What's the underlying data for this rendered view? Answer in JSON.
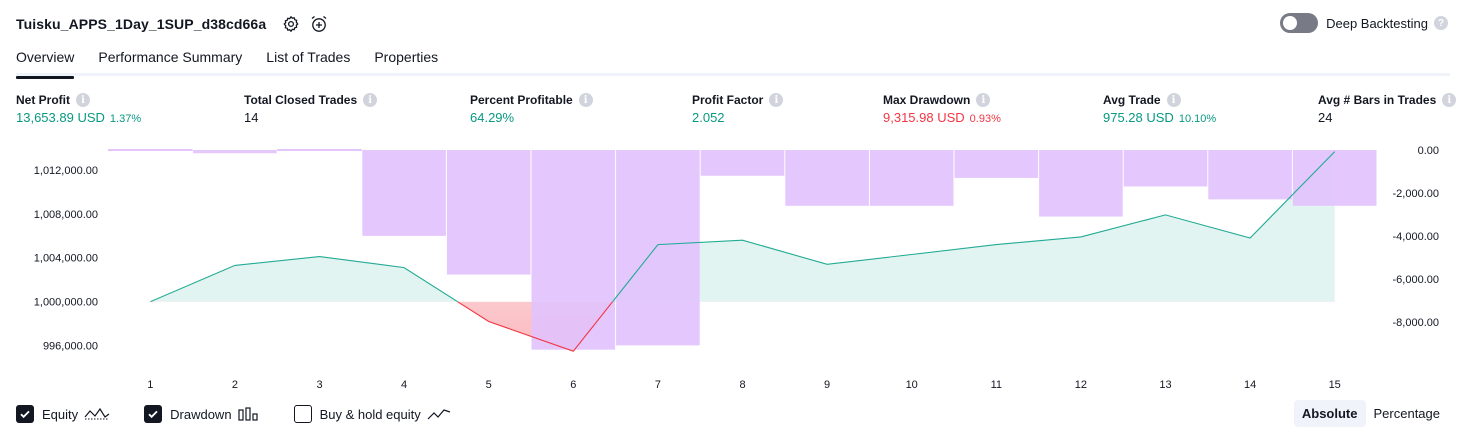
{
  "header": {
    "strategy_name": "Tuisku_APPS_1Day_1SUP_d38cd66a",
    "settings_icon": "gear-icon",
    "alert_icon": "alarm-clock-plus-icon"
  },
  "deep_backtesting": {
    "label": "Deep Backtesting",
    "enabled": false,
    "help_icon": "question-icon"
  },
  "tabs": [
    {
      "label": "Overview",
      "active": true
    },
    {
      "label": "Performance Summary",
      "active": false
    },
    {
      "label": "List of Trades",
      "active": false
    },
    {
      "label": "Properties",
      "active": false
    }
  ],
  "metrics": [
    {
      "label": "Net Profit",
      "value": "13,653.89 USD",
      "sub": "1.37%",
      "tone": "pos"
    },
    {
      "label": "Total Closed Trades",
      "value": "14",
      "sub": "",
      "tone": "neutral"
    },
    {
      "label": "Percent Profitable",
      "value": "64.29%",
      "sub": "",
      "tone": "pos"
    },
    {
      "label": "Profit Factor",
      "value": "2.052",
      "sub": "",
      "tone": "pos"
    },
    {
      "label": "Max Drawdown",
      "value": "9,315.98 USD",
      "sub": "0.93%",
      "tone": "neg"
    },
    {
      "label": "Avg Trade",
      "value": "975.28 USD",
      "sub": "10.10%",
      "tone": "pos"
    },
    {
      "label": "Avg # Bars in Trades",
      "value": "24",
      "sub": "",
      "tone": "neutral"
    }
  ],
  "colors": {
    "equity_line": "#22ab94",
    "equity_fill": "#22ab94",
    "equity_negative": "#f23645",
    "drawdown_bar": "#e1c2fd",
    "positive": "#089981",
    "negative": "#f23645"
  },
  "chart_data": {
    "type": "line",
    "x": [
      1,
      2,
      3,
      4,
      5,
      6,
      7,
      8,
      9,
      10,
      11,
      12,
      13,
      14,
      15
    ],
    "x_ticks": [
      "1",
      "2",
      "3",
      "4",
      "5",
      "6",
      "7",
      "8",
      "9",
      "10",
      "11",
      "12",
      "13",
      "14",
      "15"
    ],
    "series": [
      {
        "name": "Equity",
        "axis": "left",
        "kind": "line",
        "values": [
          1000000,
          1003300,
          1004100,
          1003100,
          998200,
          995500,
          1005200,
          1005600,
          1003400,
          1004300,
          1005200,
          1005900,
          1007900,
          1005800,
          1013650
        ]
      },
      {
        "name": "Drawdown",
        "axis": "right",
        "kind": "bar",
        "values": [
          0,
          -150,
          0,
          -4000,
          -5800,
          -9300,
          -9100,
          -1200,
          -2600,
          -2600,
          -1300,
          -3100,
          -1700,
          -2300,
          -2600
        ]
      }
    ],
    "equity_baseline": 1000000,
    "left_axis": {
      "ticks": [
        "1,012,000.00",
        "1,008,000.00",
        "1,004,000.00",
        "1,000,000.00",
        "996,000.00"
      ],
      "tick_values": [
        1012000,
        1008000,
        1004000,
        1000000,
        996000
      ],
      "range": [
        994700,
        1013800
      ]
    },
    "right_axis": {
      "ticks": [
        "0.00",
        "-2,000.00",
        "-4,000.00",
        "-6,000.00",
        "-8,000.00"
      ],
      "tick_values": [
        0,
        -2000,
        -4000,
        -6000,
        -8000
      ],
      "range": [
        -9780,
        0
      ]
    },
    "grid": false,
    "legend": "bottom-left"
  },
  "legend": [
    {
      "label": "Equity",
      "checked": true,
      "icon": "equity-line-icon"
    },
    {
      "label": "Drawdown",
      "checked": true,
      "icon": "drawdown-bars-icon"
    },
    {
      "label": "Buy & hold equity",
      "checked": false,
      "icon": "buy-hold-line-icon"
    }
  ],
  "mode": {
    "absolute": "Absolute",
    "percentage": "Percentage",
    "selected": "Absolute"
  }
}
